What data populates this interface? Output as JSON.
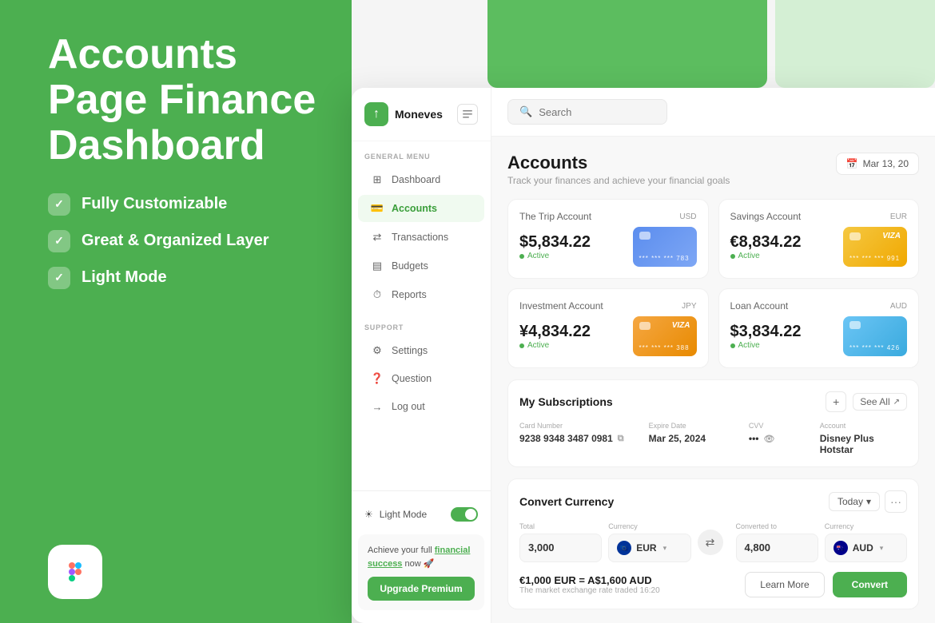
{
  "left_panel": {
    "title": "Accounts Page Finance Dashboard",
    "features": [
      {
        "id": "customizable",
        "text": "Fully Customizable"
      },
      {
        "id": "organized",
        "text": "Great & Organized Layer"
      },
      {
        "id": "light_mode",
        "text": "Light Mode"
      }
    ]
  },
  "sidebar": {
    "brand_name": "Moneves",
    "general_label": "GENERAL MENU",
    "support_label": "SUPPORT",
    "nav_items": [
      {
        "id": "dashboard",
        "label": "Dashboard",
        "icon": "⊞"
      },
      {
        "id": "accounts",
        "label": "Accounts",
        "icon": "💳"
      },
      {
        "id": "transactions",
        "label": "Transactions",
        "icon": "⇄"
      },
      {
        "id": "budgets",
        "label": "Budgets",
        "icon": "▤"
      },
      {
        "id": "reports",
        "label": "Reports",
        "icon": "⏱"
      }
    ],
    "support_items": [
      {
        "id": "settings",
        "label": "Settings",
        "icon": "⚙"
      },
      {
        "id": "question",
        "label": "Question",
        "icon": "?"
      },
      {
        "id": "logout",
        "label": "Log out",
        "icon": "→"
      }
    ],
    "light_mode_label": "Light Mode",
    "light_mode_toggle": true,
    "promo_text_before": "Achieve your full ",
    "promo_link": "financial success",
    "promo_text_after": " now 🚀",
    "upgrade_btn": "Upgrade Premium"
  },
  "topbar": {
    "search_placeholder": "Search"
  },
  "accounts_page": {
    "title": "Accounts",
    "subtitle": "Track your finances and achieve your financial goals",
    "date": "Mar 13, 20",
    "accounts": [
      {
        "name": "The Trip Account",
        "currency": "USD",
        "amount": "$5,834.22",
        "status": "Active",
        "card_type": "blue",
        "dots": "*** *** *** 783"
      },
      {
        "name": "Savings Account",
        "currency": "EUR",
        "amount": "€8,834.22",
        "status": "Active",
        "card_type": "yellow",
        "card_logo": "VIZA",
        "dots": "*** *** *** 991"
      },
      {
        "name": "Investment Account",
        "currency": "JPY",
        "amount": "¥4,834.22",
        "status": "Active",
        "card_type": "orange",
        "card_logo": "VIZA",
        "dots": "*** *** *** 388"
      },
      {
        "name": "Loan Account",
        "currency": "AUD",
        "amount": "$3,834.22",
        "status": "Active",
        "card_type": "light-blue",
        "dots": "*** *** *** 426"
      }
    ],
    "subscriptions": {
      "title": "My Subscriptions",
      "add_btn": "+",
      "see_all": "See All",
      "card_number_label": "Card Number",
      "card_number": "9238 9348 3487 0981",
      "expire_label": "Expire Date",
      "expire": "Mar 25, 2024",
      "cvv_label": "CVV",
      "cvv": "•••",
      "account_label": "Account",
      "account": "Disney Plus Hotstar"
    },
    "convert": {
      "title": "Convert Currency",
      "today_label": "Today",
      "total_label": "Total",
      "total_value": "3,000",
      "currency_label": "Currency",
      "from_currency": "EUR",
      "converted_label": "Converted to",
      "converted_value": "4,800",
      "to_currency_label": "Currency",
      "to_currency": "AUD",
      "rate": "€1,000 EUR = A$1,600 AUD",
      "rate_note": "The market exchange rate traded 16:20",
      "learn_more": "Learn More",
      "convert_btn": "Convert"
    }
  }
}
